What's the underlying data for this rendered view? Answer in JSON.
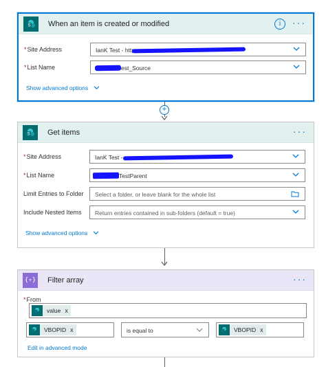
{
  "trigger": {
    "title": "When an item is created or modified",
    "site_address_label": "Site Address",
    "site_address_value": "IanK Test - http",
    "list_name_label": "List Name",
    "list_name_value": "est_Source",
    "advanced_link": "Show advanced options"
  },
  "get_items": {
    "title": "Get items",
    "site_address_label": "Site Address",
    "site_address_value": "IanK Test -",
    "list_name_label": "List Name",
    "list_name_value": "TestParent",
    "limit_label": "Limit Entries to Folder",
    "limit_placeholder": "Select a folder, or leave blank for the whole list",
    "nested_label": "Include Nested Items",
    "nested_placeholder": "Return entries contained in sub-folders (default = true)",
    "advanced_link": "Show advanced options"
  },
  "filter": {
    "title": "Filter array",
    "tile_text": "{▿}",
    "from_label": "From",
    "from_token": "value",
    "left_token": "VBOPID",
    "operator": "is equal to",
    "right_token": "VBOPID",
    "advanced_link": "Edit in advanced mode"
  },
  "glyphs": {
    "more": "···",
    "info": "i",
    "plus": "+",
    "token_remove": "x",
    "required": "*"
  },
  "colors": {
    "accent": "#0078d4",
    "sharepoint": "#036c70",
    "filter": "#8c6cd6",
    "redaction": "#1414ff"
  }
}
